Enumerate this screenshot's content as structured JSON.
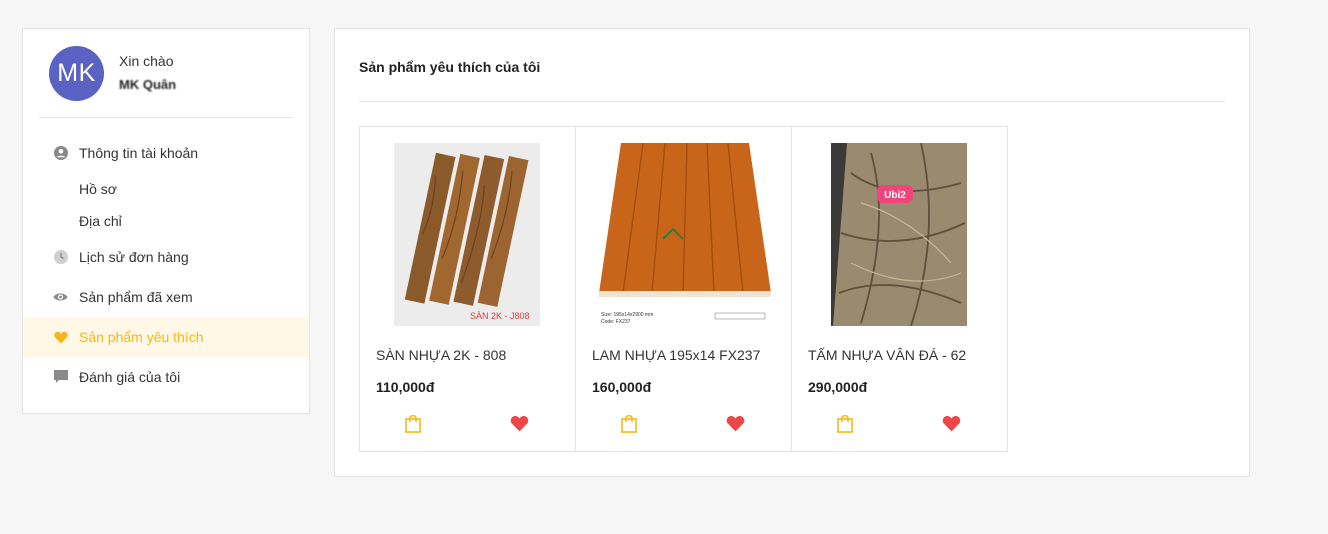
{
  "user": {
    "avatar_initials": "MK",
    "greeting": "Xin chào",
    "name": "MK Quân"
  },
  "menu": {
    "account_info": "Thông tin tài khoản",
    "profile": "Hồ sơ",
    "address": "Địa chỉ",
    "order_history": "Lịch sử đơn hàng",
    "viewed_products": "Sản phẩm đã xem",
    "favorite_products": "Sản phẩm yêu thích",
    "my_reviews": "Đánh giá của tôi"
  },
  "main": {
    "title": "Sản phẩm yêu thích của tôi"
  },
  "products": [
    {
      "name": "SÀN NHỰA 2K - 808",
      "price": "110,000đ",
      "image_label": "SÀN 2K - J808"
    },
    {
      "name": "LAM NHỰA 195x14 FX237",
      "price": "160,000đ",
      "image_label": "Size: 195x14x2900 mm",
      "image_label2": "Code: FX237"
    },
    {
      "name": "TẤM NHỰA VÂN ĐÁ - 62",
      "price": "290,000đ",
      "image_label": "Ubi2"
    }
  ],
  "colors": {
    "accent": "#f5b71a",
    "avatar": "#5a62c3",
    "heart": "#f04545",
    "active_bg": "#fff8e6"
  },
  "icons": {
    "account": "user-circle-icon",
    "history": "clock-icon",
    "viewed": "eye-icon",
    "favorite": "heart-icon",
    "reviews": "chat-icon",
    "cart": "shopping-bag-icon",
    "wishlist": "heart-icon"
  }
}
